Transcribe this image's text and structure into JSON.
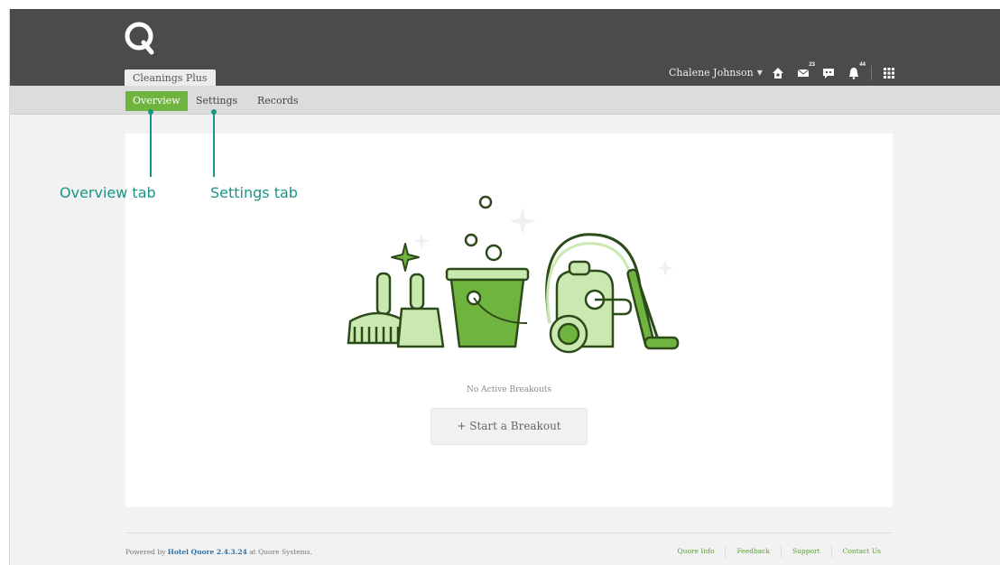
{
  "header": {
    "property_name": "Cleanings Plus",
    "user_name": "Chalene Johnson",
    "icons": [
      {
        "name": "home-icon",
        "badge": ""
      },
      {
        "name": "mail-icon",
        "badge": "23"
      },
      {
        "name": "chat-icon",
        "badge": ""
      },
      {
        "name": "bell-icon",
        "badge": "44"
      }
    ],
    "apps_icon": "grid-icon"
  },
  "nav": {
    "tabs": [
      {
        "label": "Overview",
        "active": true
      },
      {
        "label": "Settings",
        "active": false
      },
      {
        "label": "Records",
        "active": false
      }
    ]
  },
  "main": {
    "empty_message": "No Active Breakouts",
    "start_button": "+ Start a Breakout"
  },
  "footer": {
    "powered_prefix": "Powered by",
    "product": "Hotel Quore 2.4.3.24",
    "powered_suffix": "at Quore Systems.",
    "links": [
      "Quore Info",
      "Feedback",
      "Support",
      "Contact Us"
    ]
  },
  "annotations": {
    "overview": "Overview tab",
    "settings": "Settings tab"
  },
  "colors": {
    "accent": "#6fb43f",
    "topbar": "#4b4b4b",
    "annotation": "#1a9585",
    "link": "#2f6fa8"
  }
}
